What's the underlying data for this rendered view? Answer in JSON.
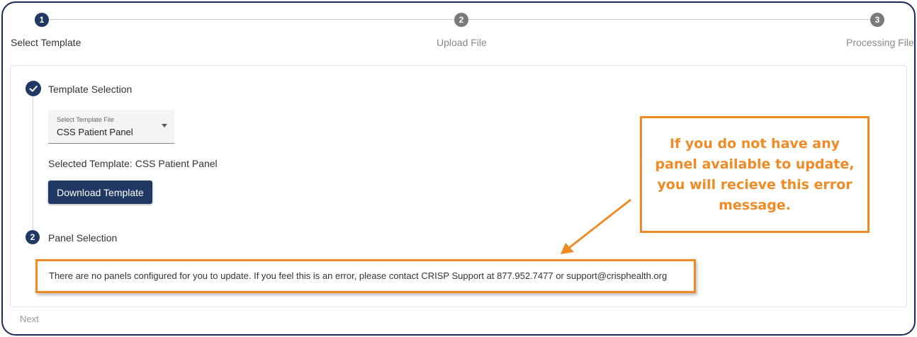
{
  "stepper": {
    "steps": [
      {
        "number": "1",
        "label": "Select Template"
      },
      {
        "number": "2",
        "label": "Upload File"
      },
      {
        "number": "3",
        "label": "Processing File"
      }
    ]
  },
  "template_section": {
    "title": "Template Selection",
    "select": {
      "caption": "Select Template File",
      "value": "CSS Patient Panel"
    },
    "selected_text": "Selected Template: CSS Patient Panel",
    "download_label": "Download Template"
  },
  "panel_section": {
    "number": "2",
    "title": "Panel Selection",
    "error_message": "There are no panels configured for you to update. If you feel this is an error, please contact CRISP Support at 877.952.7477 or support@crisphealth.org"
  },
  "annotation": {
    "text": "If you do not have any panel available to update, you will recieve this error message.",
    "color": "#f08a24"
  },
  "footer": {
    "next_label": "Next"
  },
  "colors": {
    "primary": "#1f3864",
    "frame": "#1a2b57",
    "highlight": "#f08a24"
  },
  "icons": {
    "section_complete": "check-icon",
    "select_dropdown": "caret-down-icon"
  }
}
